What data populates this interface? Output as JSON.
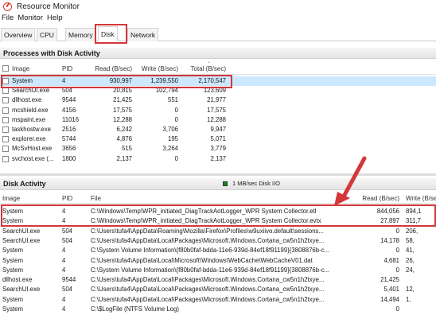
{
  "window": {
    "title": "Resource Monitor"
  },
  "menu": [
    "File",
    "Monitor",
    "Help"
  ],
  "tabs": [
    "Overview",
    "CPU",
    "Memory",
    "Disk",
    "Network"
  ],
  "processes": {
    "title": "Processes with Disk Activity",
    "columns": [
      "Image",
      "PID",
      "Read (B/sec)",
      "Write (B/sec)",
      "Total (B/sec)"
    ],
    "rows": [
      [
        "System",
        "4",
        "930,997",
        "1,239,550",
        "2,170,547"
      ],
      [
        "SearchUI.exe",
        "504",
        "20,815",
        "102,794",
        "123,609"
      ],
      [
        "dllhost.exe",
        "9544",
        "21,425",
        "551",
        "21,977"
      ],
      [
        "mcshield.exe",
        "4156",
        "17,575",
        "0",
        "17,575"
      ],
      [
        "mspaint.exe",
        "11016",
        "12,288",
        "0",
        "12,288"
      ],
      [
        "taskhostw.exe",
        "2516",
        "6,242",
        "3,706",
        "9,947"
      ],
      [
        "explorer.exe",
        "5744",
        "4,876",
        "195",
        "5,071"
      ],
      [
        "McSvHost.exe",
        "3656",
        "515",
        "3,264",
        "3,779"
      ],
      [
        "svchost.exe (...",
        "1800",
        "2,137",
        "0",
        "2,137"
      ]
    ]
  },
  "disk": {
    "title": "Disk Activity",
    "legend": "1 MB/sec Disk I/O",
    "columns": [
      "Image",
      "PID",
      "File",
      "Read (B/sec)",
      "Write (B/sec)"
    ],
    "rows": [
      [
        "System",
        "4",
        "C:\\Windows\\Temp\\WPR_initiated_DiagTrackAotLogger_WPR System Collector.etl",
        "844,056",
        "894,1"
      ],
      [
        "System",
        "4",
        "C:\\Windows\\Temp\\WPR_initiated_DiagTrackAotLogger_WPR System Collector.evtx",
        "27,897",
        "311,7"
      ],
      [
        "SearchUI.exe",
        "504",
        "C:\\Users\\tufa4\\AppData\\Roaming\\Mozilla\\Firefox\\Profiles\\w9uxiivo.default\\sessions...",
        "0",
        "206,"
      ],
      [
        "SearchUI.exe",
        "504",
        "C:\\Users\\tufa4\\AppData\\Local\\Packages\\Microsoft.Windows.Cortana_cw5n1h2txye...",
        "14,178",
        "58,"
      ],
      [
        "System",
        "4",
        "C:\\System Volume Information\\{f80b0faf-bdda-11e6-939d-84ef18f91199}{3808876b-c...",
        "0",
        "41,"
      ],
      [
        "System",
        "4",
        "C:\\Users\\tufa4\\AppData\\Local\\Microsoft\\Windows\\WebCache\\WebCacheV01.dat",
        "4,681",
        "26,"
      ],
      [
        "System",
        "4",
        "C:\\System Volume Information\\{f80b0faf-bdda-11e6-939d-84ef18f91199}{3808876b-c...",
        "0",
        "24,"
      ],
      [
        "dllhost.exe",
        "9544",
        "C:\\Users\\tufa4\\AppData\\Local\\Packages\\Microsoft.Windows.Cortana_cw5n1h2txye...",
        "21,425",
        ""
      ],
      [
        "SearchUI.exe",
        "504",
        "C:\\Users\\tufa4\\AppData\\Local\\Packages\\Microsoft.Windows.Cortana_cw5n1h2txye...",
        "5,401",
        "12,"
      ],
      [
        "System",
        "4",
        "C:\\Users\\tufa4\\AppData\\Local\\Packages\\Microsoft.Windows.Cortana_cw5n1h2txye...",
        "14,494",
        "1,"
      ],
      [
        "System",
        "4",
        "C:\\$LogFile (NTFS Volume Log)",
        "0",
        "",
        ""
      ]
    ]
  },
  "colors": {
    "highlight": "#d4373a",
    "selection": "#cce8ff"
  }
}
